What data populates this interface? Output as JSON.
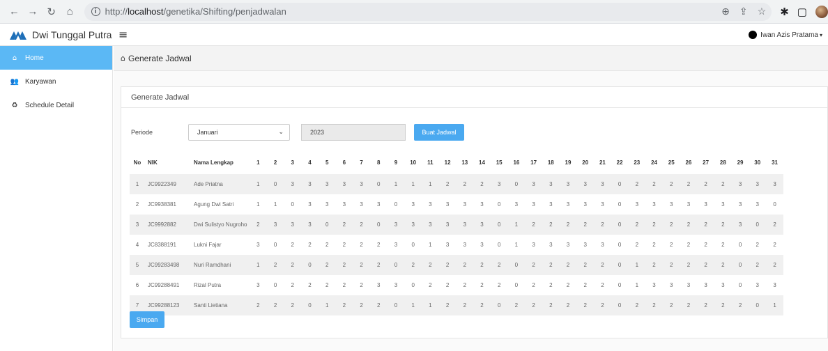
{
  "browser": {
    "url_prefix": "http://",
    "url_host": "localhost",
    "url_path": "/genetika/Shifting/penjadwalan"
  },
  "header": {
    "brand": "Dwi Tunggal Putra",
    "user_name": "Iwan Azis Pratama"
  },
  "sidebar": {
    "items": [
      {
        "label": "Home",
        "icon": "home-icon",
        "active": true
      },
      {
        "label": "Karyawan",
        "icon": "users-icon",
        "active": false
      },
      {
        "label": "Schedule Detail",
        "icon": "recycle-icon",
        "active": false
      }
    ]
  },
  "breadcrumb": {
    "title": "Generate Jadwal"
  },
  "panel": {
    "heading": "Generate Jadwal",
    "periode_label": "Periode",
    "month_value": "Januari",
    "year_value": "2023",
    "buat_button": "Buat Jadwal",
    "simpan_button": "Simpan"
  },
  "table": {
    "headers": [
      "No",
      "NIK",
      "Nama Lengkap"
    ],
    "days": [
      "1",
      "2",
      "3",
      "4",
      "5",
      "6",
      "7",
      "8",
      "9",
      "10",
      "11",
      "12",
      "13",
      "14",
      "15",
      "16",
      "17",
      "18",
      "19",
      "20",
      "21",
      "22",
      "23",
      "24",
      "25",
      "26",
      "27",
      "28",
      "29",
      "30",
      "31"
    ],
    "rows": [
      {
        "no": "1",
        "nik": "JC9922349",
        "name": "Ade Priatna",
        "values": [
          "1",
          "0",
          "3",
          "3",
          "3",
          "3",
          "3",
          "0",
          "1",
          "1",
          "1",
          "2",
          "2",
          "2",
          "3",
          "0",
          "3",
          "3",
          "3",
          "3",
          "3",
          "0",
          "2",
          "2",
          "2",
          "2",
          "2",
          "2",
          "3",
          "3",
          "3"
        ]
      },
      {
        "no": "2",
        "nik": "JC9938381",
        "name": "Agung Dwi Satri",
        "values": [
          "1",
          "1",
          "0",
          "3",
          "3",
          "3",
          "3",
          "3",
          "0",
          "3",
          "3",
          "3",
          "3",
          "3",
          "0",
          "3",
          "3",
          "3",
          "3",
          "3",
          "3",
          "0",
          "3",
          "3",
          "3",
          "3",
          "3",
          "3",
          "3",
          "3",
          "0"
        ]
      },
      {
        "no": "3",
        "nik": "JC9992882",
        "name": "Dwi Sulistyo Nugroho",
        "values": [
          "2",
          "3",
          "3",
          "3",
          "0",
          "2",
          "2",
          "0",
          "3",
          "3",
          "3",
          "3",
          "3",
          "3",
          "0",
          "1",
          "2",
          "2",
          "2",
          "2",
          "2",
          "0",
          "2",
          "2",
          "2",
          "2",
          "2",
          "2",
          "3",
          "0",
          "2"
        ]
      },
      {
        "no": "4",
        "nik": "JC8388191",
        "name": "Lukni Fajar",
        "values": [
          "3",
          "0",
          "2",
          "2",
          "2",
          "2",
          "2",
          "2",
          "3",
          "0",
          "1",
          "3",
          "3",
          "3",
          "0",
          "1",
          "3",
          "3",
          "3",
          "3",
          "3",
          "0",
          "2",
          "2",
          "2",
          "2",
          "2",
          "2",
          "0",
          "2",
          "2"
        ]
      },
      {
        "no": "5",
        "nik": "JC99283498",
        "name": "Nuri Ramdhani",
        "values": [
          "1",
          "2",
          "2",
          "0",
          "2",
          "2",
          "2",
          "2",
          "0",
          "2",
          "2",
          "2",
          "2",
          "2",
          "2",
          "0",
          "2",
          "2",
          "2",
          "2",
          "2",
          "0",
          "1",
          "2",
          "2",
          "2",
          "2",
          "2",
          "0",
          "2",
          "2"
        ]
      },
      {
        "no": "6",
        "nik": "JC99288491",
        "name": "Rizal Putra",
        "values": [
          "3",
          "0",
          "2",
          "2",
          "2",
          "2",
          "2",
          "3",
          "3",
          "0",
          "2",
          "2",
          "2",
          "2",
          "2",
          "0",
          "2",
          "2",
          "2",
          "2",
          "2",
          "0",
          "1",
          "3",
          "3",
          "3",
          "3",
          "3",
          "0",
          "3",
          "3"
        ]
      },
      {
        "no": "7",
        "nik": "JC99288123",
        "name": "Santi Lietiana",
        "values": [
          "2",
          "2",
          "2",
          "0",
          "1",
          "2",
          "2",
          "2",
          "0",
          "1",
          "1",
          "2",
          "2",
          "2",
          "0",
          "2",
          "2",
          "2",
          "2",
          "2",
          "2",
          "0",
          "2",
          "2",
          "2",
          "2",
          "2",
          "2",
          "2",
          "0",
          "1"
        ]
      }
    ]
  },
  "colors": {
    "accent": "#5bb8f5",
    "button": "#4aa9f0",
    "brand_logo": "#1e6fb8"
  }
}
